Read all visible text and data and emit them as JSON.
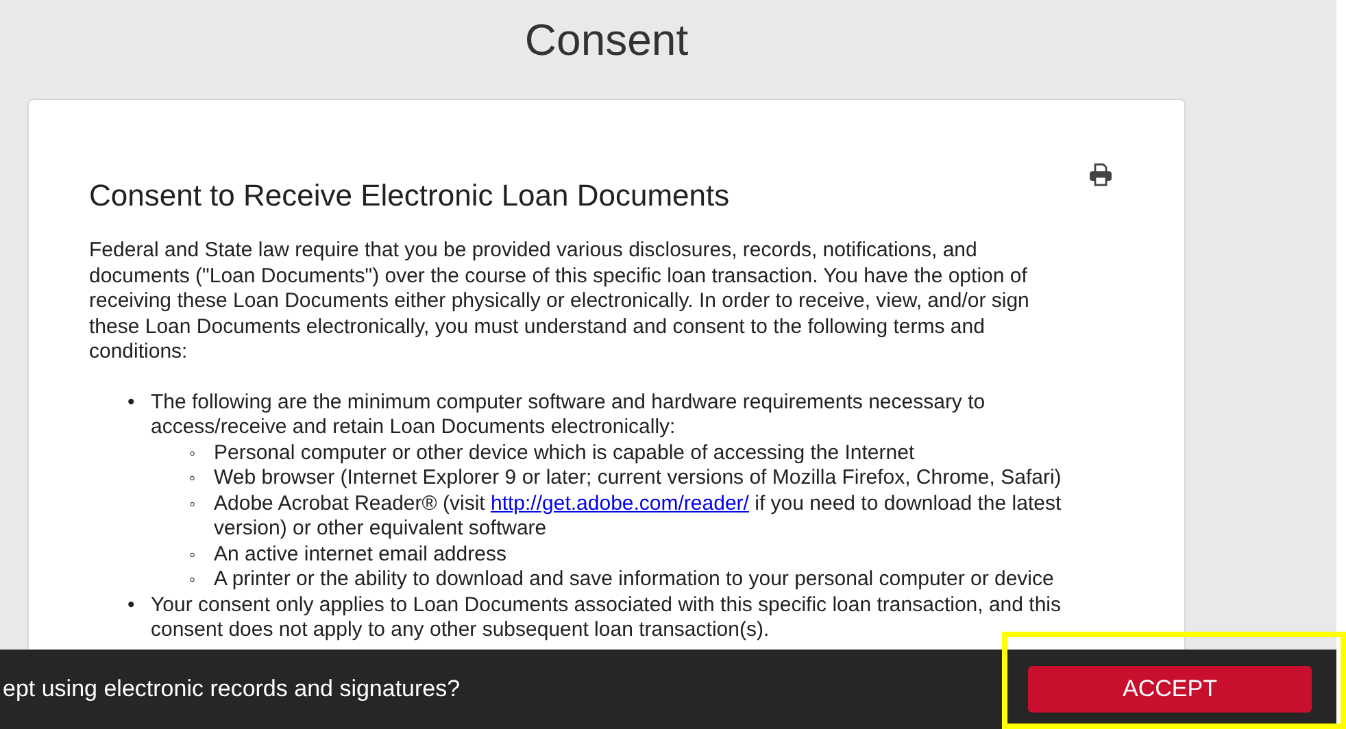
{
  "page": {
    "title": "Consent"
  },
  "document": {
    "heading": "Consent to Receive Electronic Loan Documents",
    "intro": "Federal and State law require that you be provided various disclosures, records, notifications, and documents (\"Loan Documents\") over the course of this specific loan transaction. You have the option of receiving these Loan Documents either physically or electronically. In order to receive, view, and/or sign these Loan Documents electronically, you must understand and consent to the following terms and conditions:",
    "bullets": [
      {
        "marker": "•",
        "text": "The following are the minimum computer software and hardware requirements necessary to access/receive and retain Loan Documents electronically:",
        "children": [
          {
            "marker": "◦",
            "text": "Personal computer or other device which is capable of accessing the Internet"
          },
          {
            "marker": "◦",
            "text": "Web browser (Internet Explorer 9 or later; current versions of Mozilla Firefox, Chrome, Safari)"
          },
          {
            "marker": "◦",
            "text": "Adobe Acrobat Reader® (visit",
            "link": "http://get.adobe.com/reader/",
            "after": "if you need to download the latest version) or other equivalent software"
          },
          {
            "marker": "◦",
            "text": "An active internet email address"
          },
          {
            "marker": "◦",
            "text": "A printer or the ability to download and save information to your personal computer or device"
          }
        ]
      },
      {
        "marker": "•",
        "text": "Your consent only applies to Loan Documents associated with this specific loan transaction, and this consent does not apply to any other subsequent loan transaction(s)."
      }
    ]
  },
  "consent_bar": {
    "question": "ept using electronic records and signatures?",
    "button": "ACCEPT",
    "highlighted": true
  }
}
